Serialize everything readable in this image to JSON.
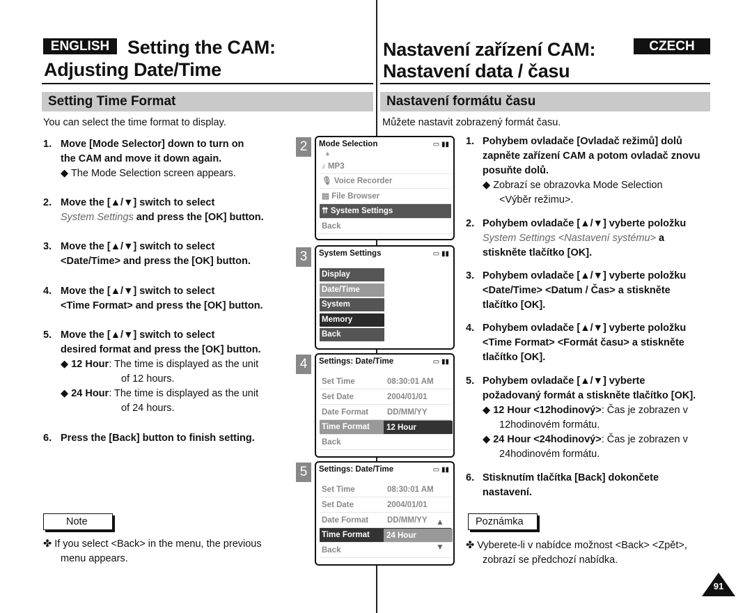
{
  "header": {
    "english_badge": "ENGLISH",
    "czech_badge": "CZECH",
    "en_title_1": "Setting the CAM:",
    "en_title_2": "Adjusting Date/Time",
    "cz_title_1": "Nastavení zařízení CAM:",
    "cz_title_2": "Nastavení data / času"
  },
  "en": {
    "section": "Setting Time Format",
    "intro": "You can select the time format to display.",
    "s1": {
      "n": "1.",
      "l1": "Move [Mode Selector] down to turn on",
      "l2": "the CAM and move it down again.",
      "bullet": "The Mode Selection screen appears."
    },
    "s2": {
      "n": "2.",
      "l1": "Move the [▲/▼] switch to select",
      "italic": "System Settings",
      "l2": " and press the [OK] button."
    },
    "s3": {
      "n": "3.",
      "l1": "Move the [▲/▼] switch to select",
      "l2": "<Date/Time> and press the [OK] button."
    },
    "s4": {
      "n": "4.",
      "l1": "Move the [▲/▼] switch to select",
      "l2": "<Time Format> and press the [OK] button."
    },
    "s5": {
      "n": "5.",
      "l1": "Move the [▲/▼] switch to select",
      "l2": "desired format and press the [OK] button.",
      "b1_bold": "12 Hour",
      "b1": ": The time is displayed as the unit",
      "b1_cont": "of 12 hours.",
      "b2_bold": "24 Hour",
      "b2": ": The time is displayed as the unit",
      "b2_cont": "of 24 hours."
    },
    "s6": {
      "n": "6.",
      "l1": "Press the [Back] button to finish setting."
    },
    "note_label": "Note",
    "note_l1": "If you select <Back> in the menu, the previous",
    "note_l2": "menu appears."
  },
  "cz": {
    "section": "Nastavení formátu času",
    "intro": "Můžete nastavit zobrazený formát času.",
    "s1": {
      "n": "1.",
      "l1": "Pohybem ovladače [Ovladač režimů] dolů",
      "l2": "zapněte zařízení CAM a potom ovladač znovu",
      "l3": "posuňte dolů.",
      "b1": "Zobrazí se obrazovka Mode Selection",
      "b2": "<Výběr režimu>."
    },
    "s2": {
      "n": "2.",
      "l1": "Pohybem ovladače [▲/▼] vyberte položku",
      "italic": "System Settings <Nastavení systému>",
      "l2a": " a",
      "l3": "stiskněte tlačítko [OK]."
    },
    "s3": {
      "n": "3.",
      "l1": "Pohybem ovladače [▲/▼] vyberte položku",
      "l2": "<Date/Time> <Datum / Čas> a stiskněte",
      "l3": "tlačítko [OK]."
    },
    "s4": {
      "n": "4.",
      "l1": "Pohybem ovladače [▲/▼] vyberte položku",
      "l2": "<Time Format> <Formát času> a stiskněte",
      "l3": "tlačítko [OK]."
    },
    "s5": {
      "n": "5.",
      "l1": "Pohybem ovladače [▲/▼] vyberte",
      "l2": "požadovaný formát a stiskněte tlačítko [OK].",
      "b1_bold": "12 Hour <12hodinový>",
      "b1": ": Čas je zobrazen v",
      "b1_cont": "12hodinovém formátu.",
      "b2_bold": "24 Hour <24hodinový>",
      "b2": ": Čas je zobrazen v",
      "b2_cont": "24hodinovém formátu."
    },
    "s6": {
      "n": "6.",
      "l1": "Stisknutím tlačítka [Back] dokončete",
      "l2": "nastavení."
    },
    "note_label": "Poznámka",
    "note_l1": "Vyberete-li v nabídce možnost <Back> <Zpět>,",
    "note_l2": "zobrazí se předchozí nabídka."
  },
  "screens": {
    "p2": {
      "num": "2",
      "title": "Mode Selection",
      "items": [
        "MP3",
        "Voice Recorder",
        "File Browser",
        "System Settings",
        "Back"
      ]
    },
    "p3": {
      "num": "3",
      "title": "System Settings",
      "items": [
        "Display",
        "Date/Time",
        "System",
        "Memory",
        "Back"
      ]
    },
    "p4": {
      "num": "4",
      "title": "Settings: Date/Time",
      "rows": [
        [
          "Set Time",
          "08:30:01 AM"
        ],
        [
          "Set Date",
          "2004/01/01"
        ],
        [
          "Date Format",
          "DD/MM/YY"
        ],
        [
          "Time Format",
          "12 Hour"
        ],
        [
          "Back",
          ""
        ]
      ]
    },
    "p5": {
      "num": "5",
      "title": "Settings: Date/Time",
      "rows": [
        [
          "Set Time",
          "08:30:01 AM"
        ],
        [
          "Set Date",
          "2004/01/01"
        ],
        [
          "Date Format",
          "DD/MM/YY"
        ],
        [
          "Time Format",
          "24 Hour"
        ],
        [
          "Back",
          ""
        ]
      ]
    }
  },
  "bullet_glyph": "◆",
  "note_glyph": "✤",
  "up_glyph": "▲",
  "down_glyph": "▼",
  "page_number": "91"
}
